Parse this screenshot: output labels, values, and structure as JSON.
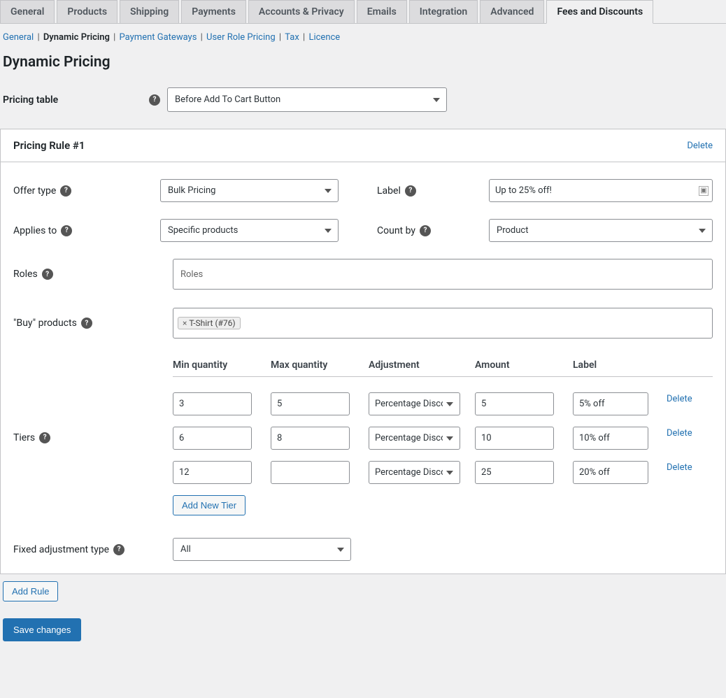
{
  "main_tabs": [
    "General",
    "Products",
    "Shipping",
    "Payments",
    "Accounts & Privacy",
    "Emails",
    "Integration",
    "Advanced",
    "Fees and Discounts"
  ],
  "main_tabs_active_index": 8,
  "sub_nav": [
    {
      "label": "General",
      "active": false
    },
    {
      "label": "Dynamic Pricing",
      "active": true
    },
    {
      "label": "Payment Gateways",
      "active": false
    },
    {
      "label": "User Role Pricing",
      "active": false
    },
    {
      "label": "Tax",
      "active": false
    },
    {
      "label": "Licence",
      "active": false
    }
  ],
  "page_title": "Dynamic Pricing",
  "pricing_table_label": "Pricing table",
  "pricing_table_value": "Before Add To Cart Button",
  "rule": {
    "title": "Pricing Rule #1",
    "delete_label": "Delete",
    "offer_type_label": "Offer type",
    "offer_type_value": "Bulk Pricing",
    "label_label": "Label",
    "label_value": "Up to 25% off!",
    "applies_to_label": "Applies to",
    "applies_to_value": "Specific products",
    "count_by_label": "Count by",
    "count_by_value": "Product",
    "roles_label": "Roles",
    "roles_placeholder": "Roles",
    "buy_products_label": "\"Buy\" products",
    "buy_products_tag": "T-Shirt (#76)",
    "tiers_label": "Tiers",
    "tiers_headers": {
      "min": "Min quantity",
      "max": "Max quantity",
      "adj": "Adjustment",
      "amount": "Amount",
      "label": "Label"
    },
    "tiers": [
      {
        "min": "3",
        "max": "5",
        "adjustment": "Percentage Discount",
        "amount": "5",
        "label": "5% off"
      },
      {
        "min": "6",
        "max": "8",
        "adjustment": "Percentage Discount",
        "amount": "10",
        "label": "10% off"
      },
      {
        "min": "12",
        "max": "",
        "adjustment": "Percentage Discount",
        "amount": "25",
        "label": "20% off"
      }
    ],
    "tier_delete_label": "Delete",
    "add_tier_label": "Add New Tier",
    "fixed_adj_label": "Fixed adjustment type",
    "fixed_adj_value": "All"
  },
  "add_rule_label": "Add Rule",
  "save_label": "Save changes"
}
